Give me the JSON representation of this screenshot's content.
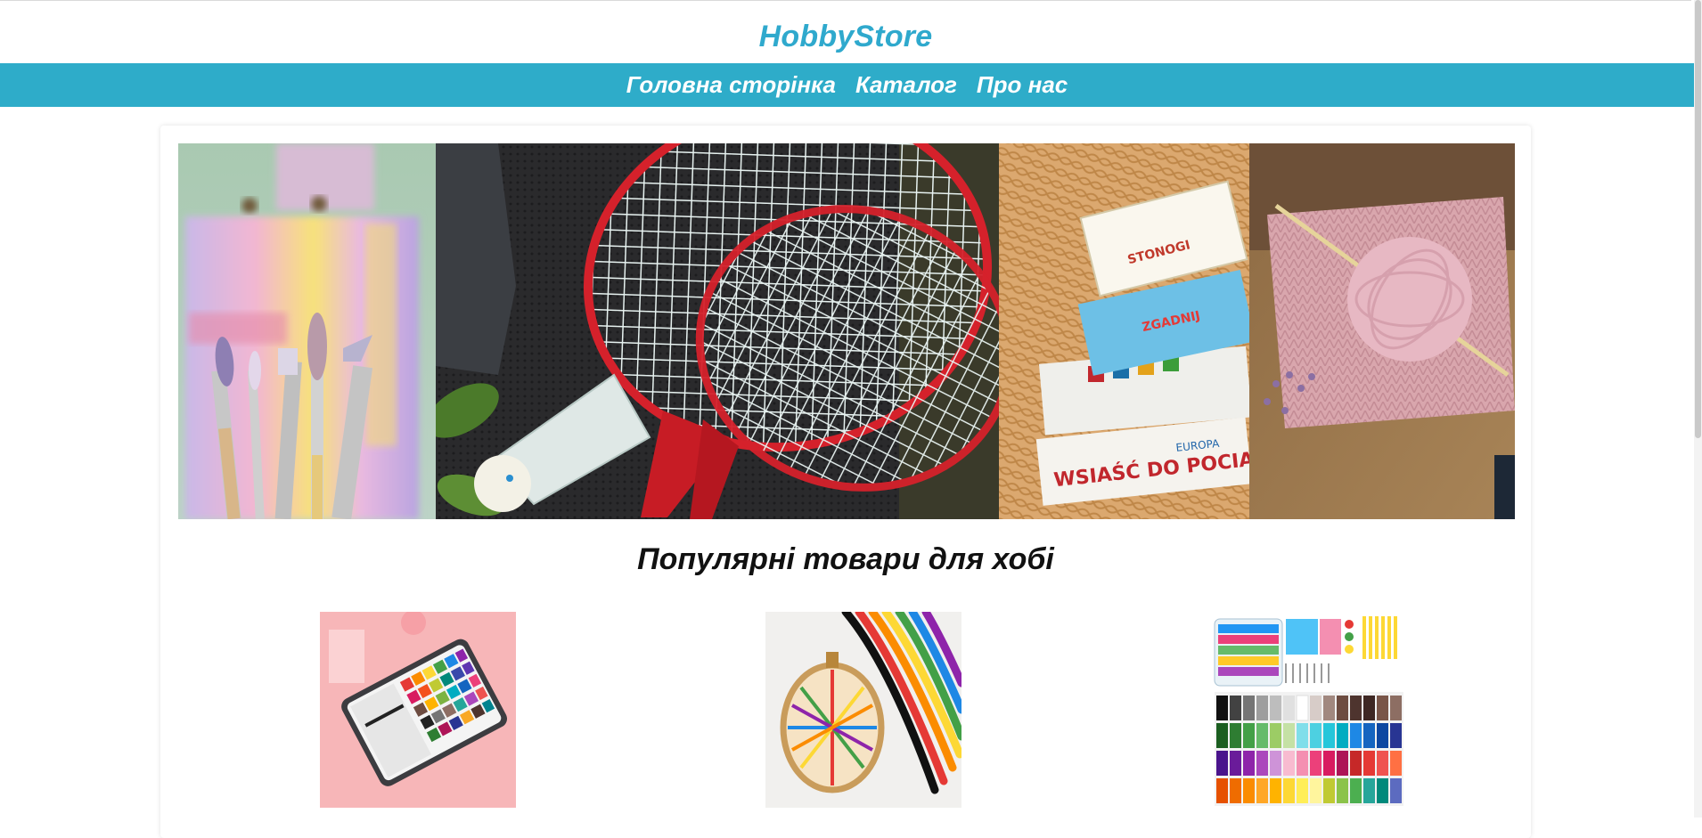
{
  "site": {
    "brand": "HobbyStore"
  },
  "nav": {
    "items": [
      {
        "label": "Головна сторінка"
      },
      {
        "label": "Каталог"
      },
      {
        "label": "Про нас"
      }
    ]
  },
  "hero": {
    "panels": [
      {
        "name": "paint-brushes-image"
      },
      {
        "name": "badminton-image"
      },
      {
        "name": "board-games-image"
      },
      {
        "name": "knitting-yarn-image"
      }
    ],
    "game_box_texts": [
      "WSIAŚĆ DO POCIĄGU",
      "EUROPA",
      "STONOGI",
      "ZGADNIJ"
    ]
  },
  "main": {
    "section_title": "Популярні товари для хобі",
    "products": [
      {
        "name": "watercolor-set"
      },
      {
        "name": "embroidery-floss"
      },
      {
        "name": "polymer-clay-kit"
      }
    ]
  },
  "colors": {
    "brand": "#2fa9cd",
    "nav_bg": "#2eacc9",
    "nav_text": "#ffffff"
  }
}
